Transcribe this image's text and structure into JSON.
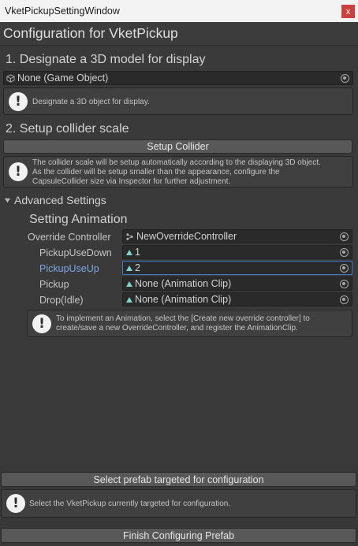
{
  "window": {
    "title": "VketPickupSettingWindow",
    "close_label": "x"
  },
  "header": {
    "title": "Configuration for VketPickup"
  },
  "section1": {
    "title": "1. Designate a 3D model for display",
    "model_field": "None (Game Object)",
    "help": "Designate a 3D object for display."
  },
  "section2": {
    "title": "2. Setup collider scale",
    "button": "Setup Collider",
    "help_line1": "The collider scale will be setup automatically according to the displaying 3D object.",
    "help_line2": "As the collider will be setup smaller than the appearance, configure the",
    "help_line3": "CapsuleCollider size via Inspector for further adjustment."
  },
  "advanced": {
    "foldout_label": "Advanced Settings",
    "subtitle": "Setting Animation",
    "rows": [
      {
        "label": "Override Controller",
        "value": "NewOverrideController"
      },
      {
        "label": "PickupUseDown",
        "value": "1"
      },
      {
        "label": "PickupUseUp",
        "value": "2"
      },
      {
        "label": "Pickup",
        "value": "None (Animation Clip)"
      },
      {
        "label": "Drop(Idle)",
        "value": "None (Animation Clip)"
      }
    ],
    "help_line1": "To implement an Animation, select the [Create new override controller] to",
    "help_line2": "create/save a new OverrideController, and register the AnimationClip."
  },
  "footer": {
    "select_button": "Select prefab targeted for configuration",
    "help": "Select the VketPickup currently targeted for configuration.",
    "finish_button": "Finish Configuring Prefab"
  },
  "colors": {
    "background": "#383838",
    "accent_focus": "#3f7ac9",
    "active_label": "#7ba7e3",
    "close_button": "#c9403f"
  }
}
